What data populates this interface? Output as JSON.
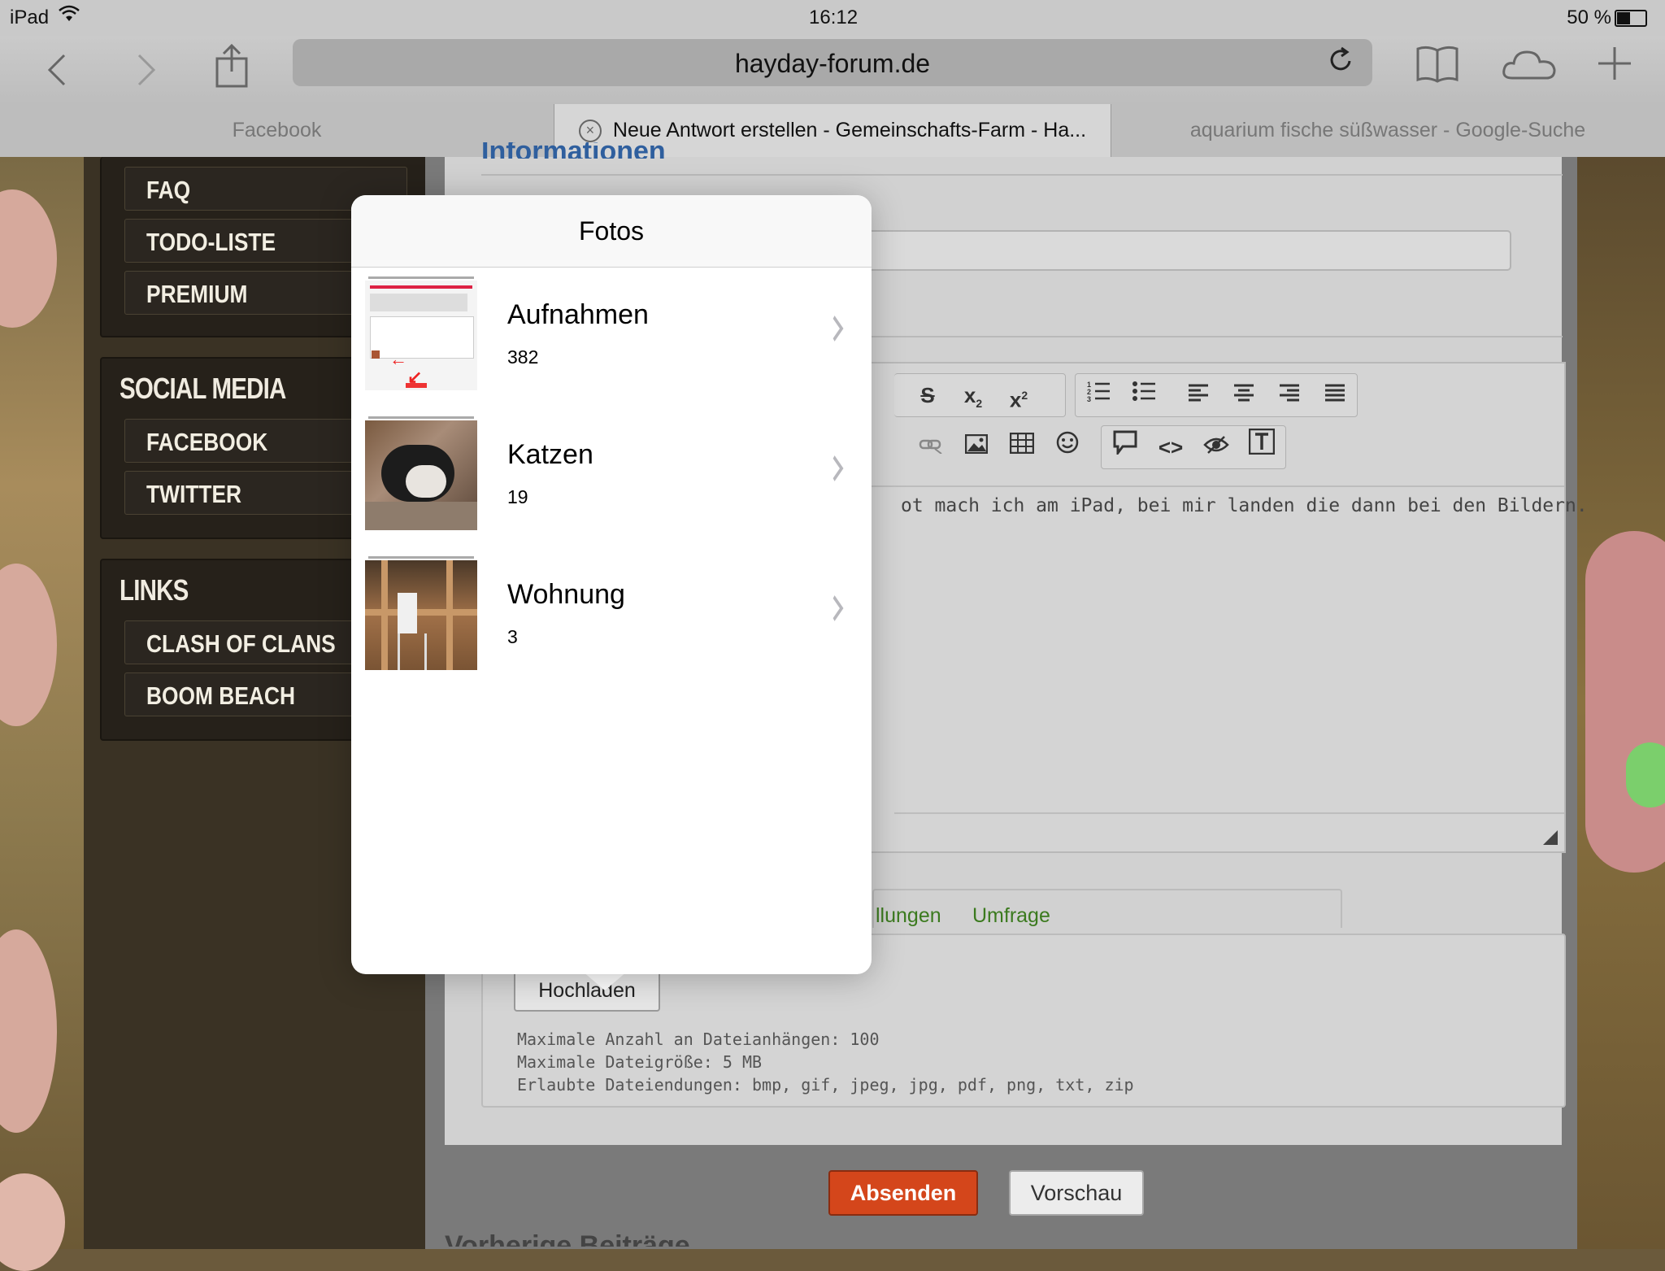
{
  "statusbar": {
    "device": "iPad",
    "time": "16:12",
    "battery": "50 %"
  },
  "browser": {
    "url": "hayday-forum.de",
    "tabs": [
      {
        "label": "Facebook",
        "active": false
      },
      {
        "label": "Neue Antwort erstellen - Gemeinschafts-Farm - Ha...",
        "active": true
      },
      {
        "label": "aquarium fische süßwasser - Google-Suche",
        "active": false
      }
    ]
  },
  "sidebar": {
    "top_items": [
      "FAQ",
      "TODO-LISTE",
      "PREMIUM"
    ],
    "social": {
      "heading": "SOCIAL MEDIA",
      "items": [
        "FACEBOOK",
        "TWITTER"
      ]
    },
    "links": {
      "heading": "LINKS",
      "items": [
        "CLASH OF CLANS",
        "BOOM BEACH"
      ]
    }
  },
  "editor": {
    "heading_partial": "Informationen",
    "body_text": "ot mach ich am iPad, bei mir landen die dann bei den Bildern."
  },
  "tabs_below": {
    "settings": "llungen",
    "poll": "Umfrage"
  },
  "upload": {
    "button": "Hochladen",
    "info": [
      "Maximale Anzahl an Dateianhängen: 100",
      "Maximale Dateigröße: 5 MB",
      "Erlaubte Dateiendungen: bmp, gif, jpeg, jpg, pdf, png, txt, zip"
    ]
  },
  "actions": {
    "submit": "Absenden",
    "preview": "Vorschau"
  },
  "bottom_heading": "Vorherige Beiträge",
  "popover": {
    "title": "Fotos",
    "albums": [
      {
        "title": "Aufnahmen",
        "count": "382"
      },
      {
        "title": "Katzen",
        "count": "19"
      },
      {
        "title": "Wohnung",
        "count": "3"
      }
    ]
  },
  "colors": {
    "submit": "#d4461b",
    "link_green": "#3b7a1e",
    "popover_bg": "#ffffff"
  }
}
